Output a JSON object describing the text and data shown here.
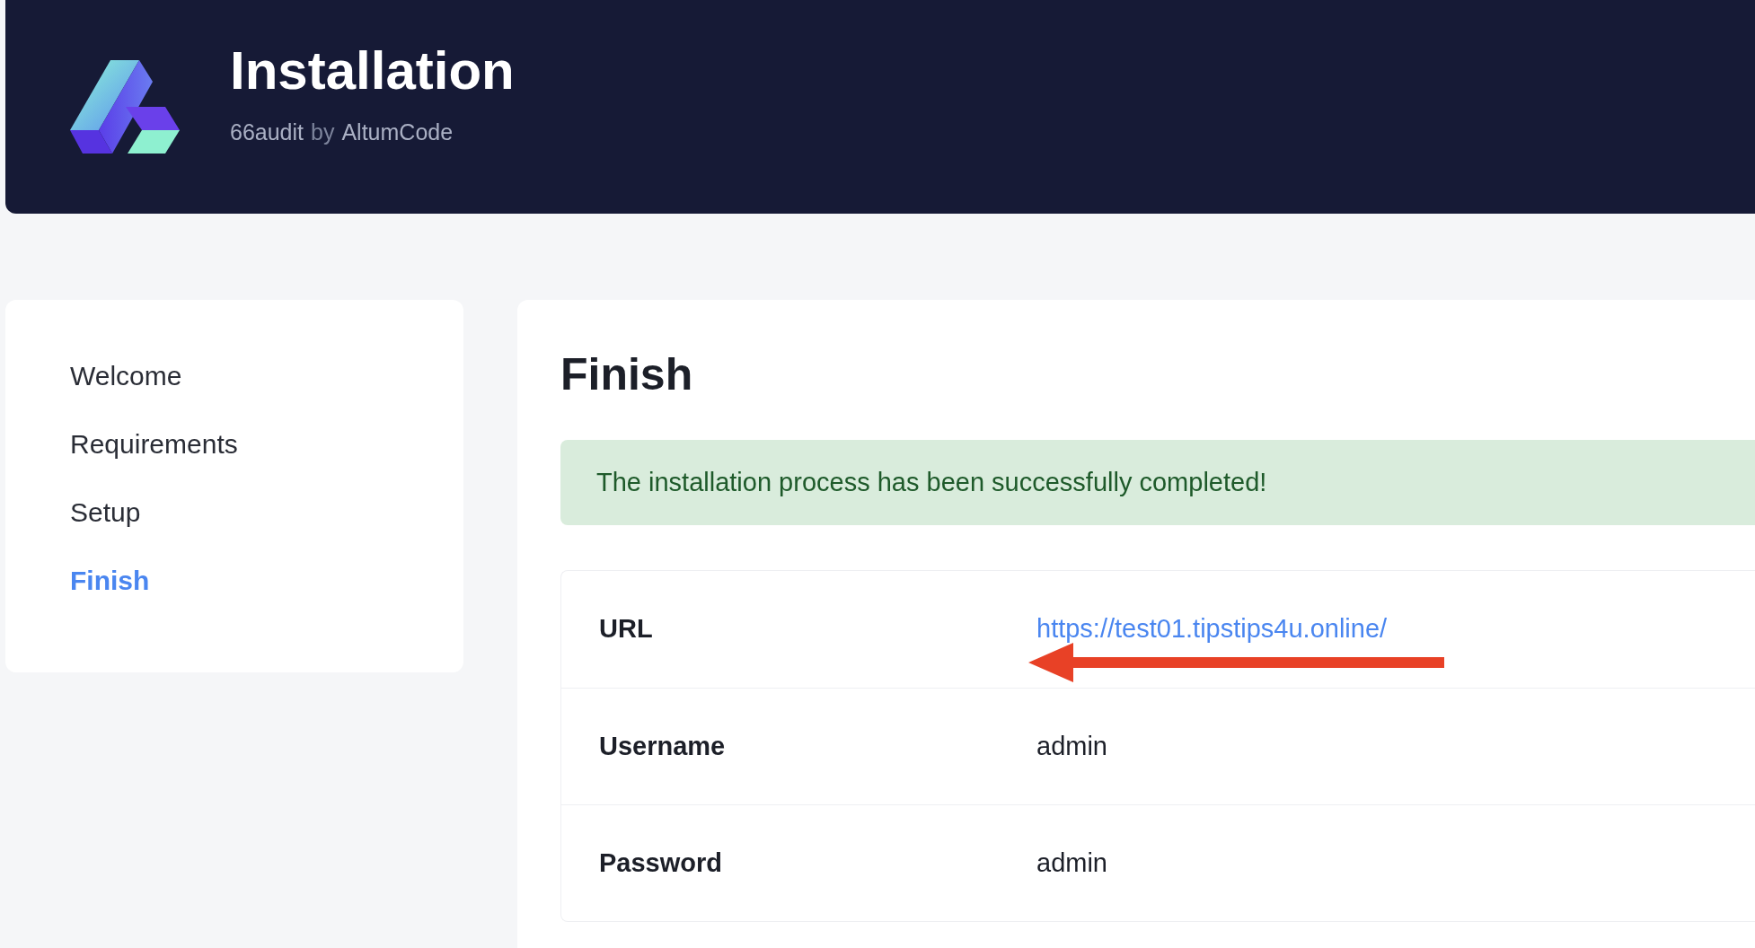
{
  "header": {
    "title": "Installation",
    "product": "66audit",
    "by": "by",
    "author": "AltumCode"
  },
  "steps": [
    {
      "label": "Welcome",
      "selected": false
    },
    {
      "label": "Requirements",
      "selected": false
    },
    {
      "label": "Setup",
      "selected": false
    },
    {
      "label": "Finish",
      "selected": true
    }
  ],
  "main": {
    "heading": "Finish",
    "alert": "The installation process has been successfully completed!",
    "rows": [
      {
        "label": "URL",
        "value": "https://test01.tipstips4u.online/",
        "kind": "link"
      },
      {
        "label": "Username",
        "value": "admin",
        "kind": "text"
      },
      {
        "label": "Password",
        "value": "admin",
        "kind": "text"
      }
    ]
  }
}
